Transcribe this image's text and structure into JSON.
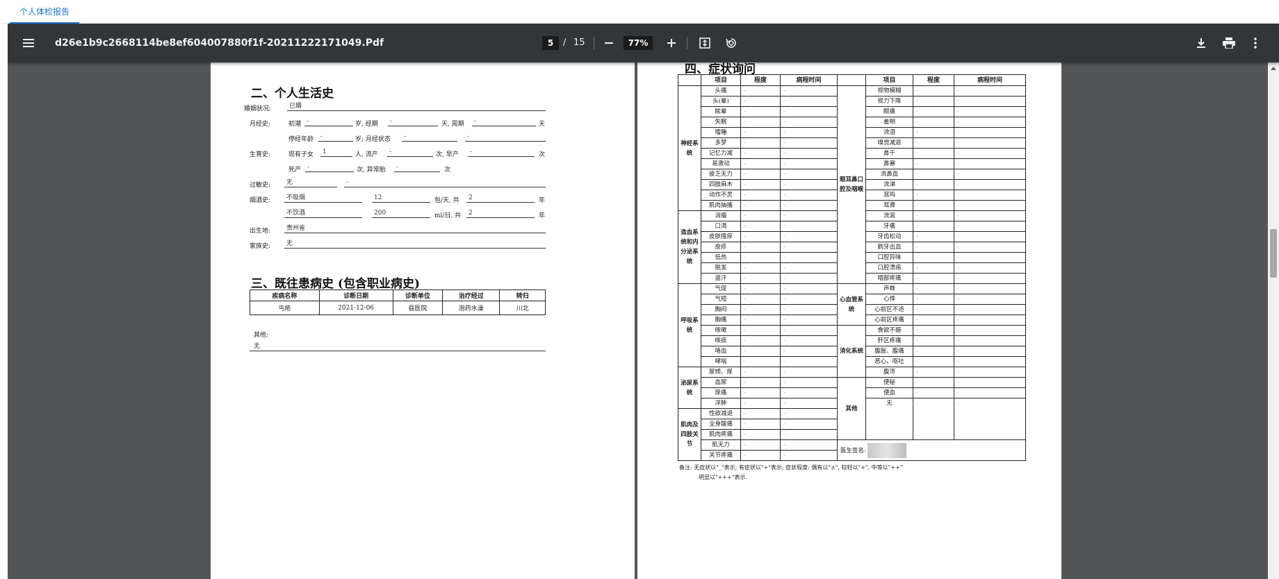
{
  "tabbar": {
    "tab_label": "个人体检报告"
  },
  "toolbar": {
    "filename": "d26e1b9c2668114be8ef604007880f1f-20211222171049.Pdf",
    "current_page": "5",
    "page_sep": "/",
    "total_pages": "15",
    "zoom": "77%",
    "zoom_out_icon": "minus-icon",
    "zoom_in_icon": "plus-icon",
    "menu_icon": "hamburger-menu-icon",
    "fit_icon": "fit-to-page-icon",
    "rotate_icon": "rotate-icon",
    "download_icon": "download-icon",
    "print_icon": "print-icon",
    "more_icon": "more-vertical-icon"
  },
  "page1": {
    "section2_title": "二、个人生活史",
    "marital_label": "婚姻状况:",
    "marital_value": "已婚",
    "menstrual_label": "月经史:",
    "menarche_label": "初潮",
    "menarche_value": "-",
    "age_period_label": "岁, 经期",
    "period_value": "-",
    "days_cycle_label": "天, 周期",
    "cycle_value": "-",
    "days_label": "天",
    "menopause_label": "停经年龄",
    "menopause_value": "-",
    "age_status_label": "岁; 月经状态",
    "status_value": "-",
    "status_value2": "-",
    "birth_label": "生育史:",
    "children_label": "现有子女",
    "children_value": "1",
    "abortion_label": "人, 流产",
    "abortion_value": "-",
    "premature_label": "次, 早产",
    "premature_value": "-",
    "times_label": "次",
    "stillbirth_label": "死产",
    "stillbirth_value": "-",
    "abnormal_label": "次, 异常胎",
    "abnormal_value": "-",
    "times_label2": "次",
    "allergy_label": "过敏史:",
    "allergy_value": "无",
    "allergy_value2": "-",
    "smoke_label": "烟酒史:",
    "smoke_status": "不吸烟",
    "smoke_amount": "12",
    "smoke_unit": "包/天, 共",
    "smoke_years": "2",
    "year_label": "年",
    "drink_status": "不饮酒",
    "drink_amount": "200",
    "drink_unit": "ml/日, 共",
    "drink_years": "2",
    "year_label2": "年",
    "birthplace_label": "出生地:",
    "birthplace_value": "贵州省",
    "family_label": "家族史:",
    "family_value": "无",
    "section3_title": "三、既往患病史 (包含职业病史)",
    "disease_headers": [
      "疾病名称",
      "诊断日期",
      "诊断单位",
      "治疗经过",
      "转归"
    ],
    "disease_row": [
      "丐疮",
      "2021-12-06",
      "县医院",
      "泡药水澡",
      "川北"
    ],
    "other_label": "其他:",
    "other_value": "无"
  },
  "page2": {
    "section4_title": "四、症状询问",
    "headers": [
      "项目",
      "程度",
      "病程时间",
      "项目",
      "程度",
      "病程时间"
    ],
    "rows": [
      [
        "头痛",
        "-",
        "-",
        "视物模糊",
        "-",
        "-"
      ],
      [
        "头(晕)",
        "-",
        "-",
        "视力下降",
        "-",
        "-"
      ],
      [
        "眩晕",
        "-",
        "-",
        "眼痛",
        "-",
        "-"
      ],
      [
        "失眠",
        "-",
        "-",
        "羞明",
        "-",
        "-"
      ],
      [
        "嗜睡",
        "-",
        "-",
        "流泪",
        "-",
        "-"
      ],
      [
        "多梦",
        "-",
        "-",
        "嗅觉减退",
        "-",
        "-"
      ],
      [
        "记忆力减",
        "-",
        "-",
        "鼻干",
        "-",
        "-"
      ],
      [
        "易激动",
        "-",
        "-",
        "鼻塞",
        "-",
        "-"
      ],
      [
        "疲乏无力",
        "-",
        "-",
        "流鼻血",
        "-",
        "-"
      ],
      [
        "四肢麻木",
        "-",
        "-",
        "流涕",
        "-",
        "-"
      ],
      [
        "动作不灵",
        "-",
        "-",
        "耳鸣",
        "-",
        "-"
      ],
      [
        "肌肉抽搐",
        "-",
        "-",
        "耳聋",
        "-",
        "-"
      ],
      [
        "消瘦",
        "-",
        "-",
        "流涎",
        "-",
        "-"
      ],
      [
        "口渴",
        "-",
        "-",
        "牙痛",
        "-",
        "-"
      ],
      [
        "皮肤瘙痒",
        "-",
        "-",
        "牙齿松动",
        "-",
        "-"
      ],
      [
        "皮疹",
        "-",
        "-",
        "刷牙出血",
        "-",
        "-"
      ],
      [
        "低热",
        "-",
        "-",
        "口腔异味",
        "-",
        "-"
      ],
      [
        "脱发",
        "-",
        "-",
        "口腔溃疡",
        "-",
        "-"
      ],
      [
        "盗汗",
        "-",
        "-",
        "咽部疼痛",
        "-",
        "-"
      ],
      [
        "气促",
        "-",
        "-",
        "声嘶",
        "-",
        "-"
      ],
      [
        "气短",
        "-",
        "-",
        "心悸",
        "-",
        "-"
      ],
      [
        "胸闷",
        "-",
        "-",
        "心前区不适",
        "-",
        "-"
      ],
      [
        "胸痛",
        "-",
        "-",
        "心前区疼痛",
        "-",
        "-"
      ],
      [
        "咳嗽",
        "-",
        "-",
        "食欲不振",
        "-",
        "-"
      ],
      [
        "咳痰",
        "-",
        "-",
        "肝区疼痛",
        "-",
        "-"
      ],
      [
        "咯血",
        "-",
        "-",
        "腹胀、腹痛",
        "-",
        "-"
      ],
      [
        "哮喘",
        "-",
        "-",
        "恶心、呕吐",
        "-",
        "-"
      ],
      [
        "尿频、尿",
        "-",
        "-",
        "腹泻",
        "-",
        "-"
      ],
      [
        "血尿",
        "-",
        "-",
        "便秘",
        "-",
        "-"
      ],
      [
        "尿痛",
        "-",
        "-",
        "便血",
        "-",
        "-"
      ],
      [
        "浮肿",
        "-",
        "-",
        "无",
        "-",
        "-"
      ],
      [
        "性欲减退",
        "-",
        "-"
      ],
      [
        "全身酸痛",
        "-",
        "-"
      ],
      [
        "肌肉疼痛",
        "-",
        "-"
      ],
      [
        "肌无力",
        "-",
        "-"
      ],
      [
        "关节疼痛",
        "-",
        "-"
      ]
    ],
    "left_groups": [
      "神经系统",
      "造血系统和内分泌系统",
      "呼吸系统",
      "泌尿系统",
      "肌肉及四肢关节"
    ],
    "right_groups": [
      "眼耳鼻口腔及咽喉",
      "心血管系统",
      "消化系统",
      "其他"
    ],
    "doctor_sign_label": "医生签名:",
    "note_line1": "备注: 无症状以\"_\"表示; 有症状以\"+\"表示; 症状程度: 偶有以\"±\", 较轻以\"+\", 中等以\"++\"",
    "note_line2": "明显以\"+++\"表示."
  }
}
